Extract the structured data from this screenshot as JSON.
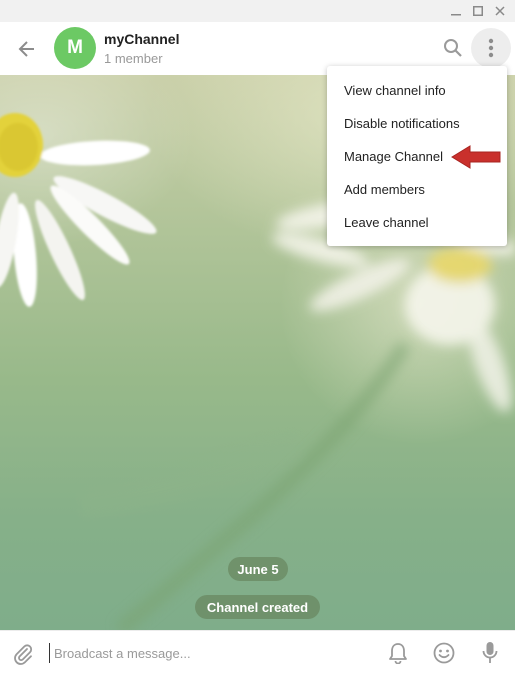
{
  "window": {
    "controls": [
      "minimize-icon",
      "maximize-icon",
      "close-icon"
    ]
  },
  "header": {
    "avatar_letter": "M",
    "channel_name": "myChannel",
    "subtitle": "1 member",
    "avatar_color": "#6cc964"
  },
  "menu": {
    "items": [
      {
        "label": "View channel info"
      },
      {
        "label": "Disable notifications"
      },
      {
        "label": "Manage Channel"
      },
      {
        "label": "Add members"
      },
      {
        "label": "Leave channel"
      }
    ],
    "highlight_arrow_color": "#c9302c"
  },
  "chat": {
    "date_label": "June 5",
    "service_message": "Channel created"
  },
  "compose": {
    "placeholder": "Broadcast a message..."
  }
}
